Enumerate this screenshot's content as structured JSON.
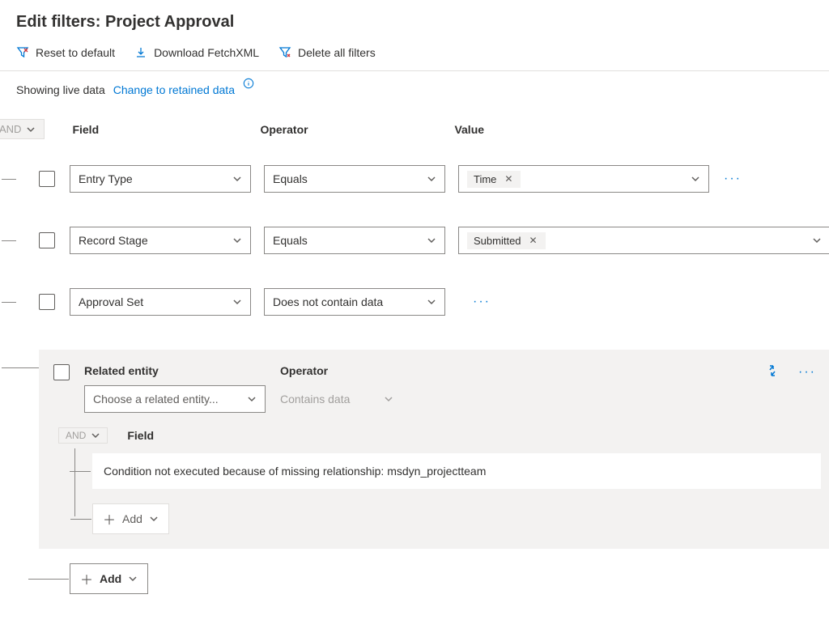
{
  "title": "Edit filters: Project Approval",
  "toolbar": {
    "reset_label": "Reset to default",
    "download_label": "Download FetchXML",
    "delete_label": "Delete all filters"
  },
  "live": {
    "showing_text": "Showing live data",
    "change_link": "Change to retained data"
  },
  "group": {
    "operator": "AND",
    "headers": {
      "field": "Field",
      "operator": "Operator",
      "value": "Value"
    }
  },
  "rows": [
    {
      "field": "Entry Type",
      "operator": "Equals",
      "value_tag": "Time"
    },
    {
      "field": "Record Stage",
      "operator": "Equals",
      "value_tag": "Submitted"
    },
    {
      "field": "Approval Set",
      "operator": "Does not contain data"
    }
  ],
  "related": {
    "entity_label": "Related entity",
    "operator_label": "Operator",
    "entity_placeholder": "Choose a related entity...",
    "operator_value": "Contains data",
    "inner": {
      "operator": "AND",
      "field_label": "Field",
      "message": "Condition not executed because of missing relationship: msdyn_projectteam",
      "add_label": "Add"
    }
  },
  "footer": {
    "add_label": "Add"
  }
}
